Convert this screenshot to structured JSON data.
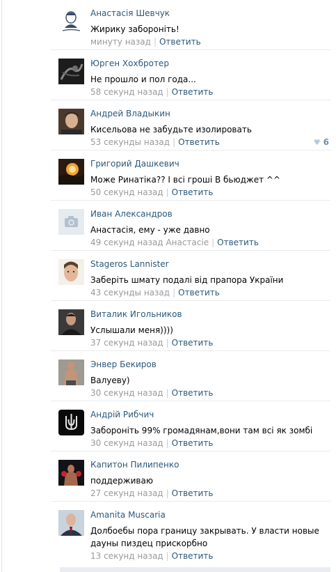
{
  "comments": [
    {
      "author": "Анастасія Шевчук",
      "text": "Жирику забороніть!",
      "time": "минуту назад",
      "reply": "Ответить",
      "avatar": "portrait-sketch"
    },
    {
      "author": "Юрген Хохбротер",
      "text": "Не прошло и пол года...",
      "time": "58 секунд назад",
      "reply": "Ответить",
      "avatar": "dark-photo"
    },
    {
      "author": "Андрей Владыкин",
      "text": "Кисельова не забудьте изолировать",
      "time": "53 секунды назад",
      "reply": "Ответить",
      "avatar": "man-photo",
      "likes": "6"
    },
    {
      "author": "Григорий Дашкевич",
      "text": "Може Ринатіка?? І всі гроші В бьюджет ^^",
      "time": "50 секунд назад",
      "reply": "Ответить",
      "avatar": "sunset-photo"
    },
    {
      "author": "Иван Александров",
      "text": "Анастасія, ему - уже давно",
      "time": "49 секунд назад",
      "to": "Анастасіе",
      "reply": "Ответить",
      "avatar": "camera-placeholder"
    },
    {
      "author": "Stageros Lannister",
      "text": "Заберіть шмату подалі від прапора України",
      "time": "43 секунды назад",
      "reply": "Ответить",
      "avatar": "face-photo"
    },
    {
      "author": "Виталик Игольников",
      "text": "Услышали меня))))",
      "time": "37 секунд назад",
      "reply": "Ответить",
      "avatar": "man-dark-photo"
    },
    {
      "author": "Энвер Бекиров",
      "text": "Валуеву)",
      "time": "30 секунд назад",
      "reply": "Ответить",
      "avatar": "shirtless-photo"
    },
    {
      "author": "Андрій Рибчич",
      "text": "Забороніть 99% громадянам,вони там всі як зомбі",
      "time": "30 секунд назад",
      "reply": "Ответить",
      "avatar": "trident-emblem"
    },
    {
      "author": "Капитон Пилипенко",
      "text": "поддерживаю",
      "time": "27 секунд назад",
      "reply": "Ответить",
      "avatar": "boxer-photo"
    },
    {
      "author": "Amanita Muscaria",
      "text": "Долбоебы пора границу закрывать. У власти новые дауны пиздец прискорбно",
      "time": "13 секунд назад",
      "reply": "Ответить",
      "avatar": "politician-photo"
    }
  ],
  "colors": {
    "link": "#2b587a",
    "meta": "#999999",
    "separator": "#e7eaee",
    "like": "#6d8fb3"
  }
}
